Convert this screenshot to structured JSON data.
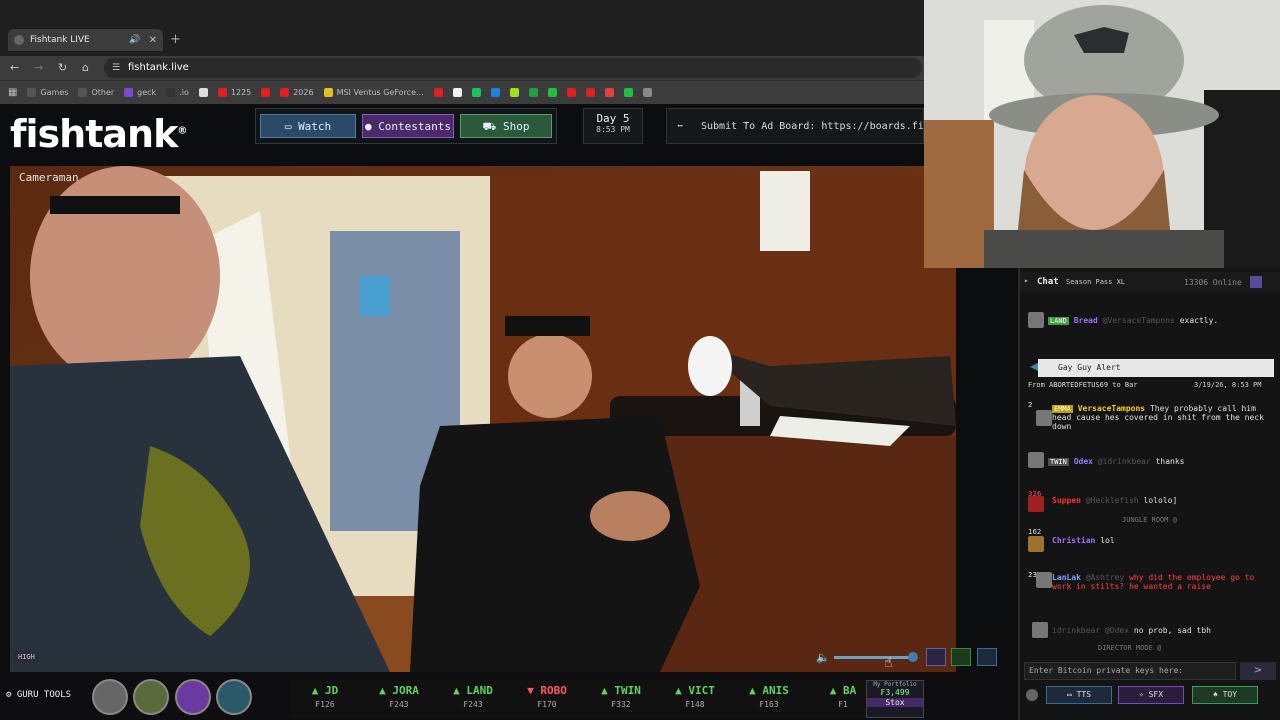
{
  "browser": {
    "tab_title": "Fishtank LIVE",
    "url": "fishtank.live",
    "bookmarks": [
      {
        "label": "Games",
        "color": "#555555"
      },
      {
        "label": "Other",
        "color": "#555555"
      },
      {
        "label": "geck",
        "color": "#7a4ad0"
      },
      {
        "label": ".io",
        "color": "#333333"
      },
      {
        "label": "",
        "color": "#dddddd"
      },
      {
        "label": "1225",
        "color": "#e02020"
      },
      {
        "label": "",
        "color": "#e02020"
      },
      {
        "label": "2026",
        "color": "#e02020"
      },
      {
        "label": "MSI Ventus GeForce...",
        "color": "#e0c020"
      },
      {
        "label": "",
        "color": "#e02020"
      },
      {
        "label": "",
        "color": "#f0f0f0"
      },
      {
        "label": "",
        "color": "#20c060"
      },
      {
        "label": "",
        "color": "#2080e0"
      },
      {
        "label": "",
        "color": "#a0e020"
      },
      {
        "label": "",
        "color": "#20a040"
      },
      {
        "label": "",
        "color": "#20c040"
      },
      {
        "label": "",
        "color": "#e02020"
      },
      {
        "label": "",
        "color": "#e02020"
      },
      {
        "label": "",
        "color": "#e04040"
      },
      {
        "label": "",
        "color": "#20c040"
      },
      {
        "label": "",
        "color": "#888888"
      }
    ]
  },
  "site": {
    "logo": "fishtank",
    "logo_mark": "®",
    "nav": {
      "watch": "Watch",
      "contestants": "Contestants",
      "shop": "Shop"
    },
    "day": "Day 5",
    "time": "8:53 PM",
    "ad_text": "Submit To Ad Board: https://boards.fish"
  },
  "video": {
    "camera_label": "Cameraman",
    "quality": "HIGH",
    "volume_level": 0.95
  },
  "chat": {
    "title": "Chat",
    "pass": "Season Pass XL",
    "online": "13306 Online",
    "alert_title": "Gay Guy Alert",
    "alert_from": "From ABORTEDFETUS69 to Bar",
    "alert_time": "3/19/26, 8:53 PM",
    "messages": [
      {
        "tag": "LAND",
        "tag_color": "#3aa03a",
        "user": "Bread",
        "user_color": "#a070ff",
        "mention": "@VersaceTampons",
        "text": "exactly."
      },
      {
        "tag": "EMMA",
        "tag_color": "#c0a000",
        "user": "VersaceTampons",
        "user_color": "#ffd000",
        "mention": "",
        "text": "They probably call him head cause hes covered in shit from the neck down",
        "level": "2"
      },
      {
        "tag": "TWIN",
        "tag_color": "#505050",
        "user": "Odex",
        "user_color": "#9a7aff",
        "mention": "@idrinkbear",
        "text": "thanks"
      },
      {
        "tag": "",
        "tag_color": "",
        "user": "Suppen",
        "user_color": "#ff3030",
        "mention": "@Hecklefish",
        "text": "lololo]",
        "level": "326"
      },
      {
        "tag": "",
        "tag_color": "",
        "user": "Christian",
        "user_color": "#a070ff",
        "mention": "",
        "text": "lol",
        "level": "162"
      },
      {
        "tag": "",
        "tag_color": "",
        "user": "LanLak",
        "user_color": "#7aa0ff",
        "mention": "@Ashtrey",
        "text": "why did the employee go to work in stilts? he wanted a raise",
        "level": "23",
        "text_color": "#ff4040"
      },
      {
        "tag": "",
        "tag_color": "",
        "user": "",
        "user_color": "#888",
        "mention": "idrinkbear @Odex",
        "text": "no prob, sad tbh"
      }
    ],
    "system_lines": [
      "JUNGLE ROOM @",
      "DIRECTOR MODE @"
    ],
    "input_placeholder": "Enter Bitcoin private keys here:",
    "send": ">",
    "buttons": {
      "tts": "TTS",
      "sfx": "SFX",
      "toy": "TOY"
    }
  },
  "bottom": {
    "guru": "GURU TOOLS",
    "ticker": [
      {
        "name": "JD",
        "price": "₣126",
        "dir": "up"
      },
      {
        "name": "JORA",
        "price": "₣243",
        "dir": "up"
      },
      {
        "name": "LAND",
        "price": "₣243",
        "dir": "up"
      },
      {
        "name": "ROBO",
        "price": "₣170",
        "dir": "down"
      },
      {
        "name": "TWIN",
        "price": "₣332",
        "dir": "up"
      },
      {
        "name": "VICT",
        "price": "₣148",
        "dir": "up"
      },
      {
        "name": "ANIS",
        "price": "₣163",
        "dir": "up"
      },
      {
        "name": "BA",
        "price": "₣1",
        "dir": "up"
      }
    ],
    "portfolio_label": "My Portfolio",
    "portfolio_value": "₣3,499",
    "stox": "Stox"
  },
  "colors": {
    "up": "#5fd35f",
    "down": "#ff5a5a",
    "watch_bg": "#2a4a6a",
    "contestants_bg": "#4a2a6a",
    "shop_bg": "#2a5a3a"
  }
}
